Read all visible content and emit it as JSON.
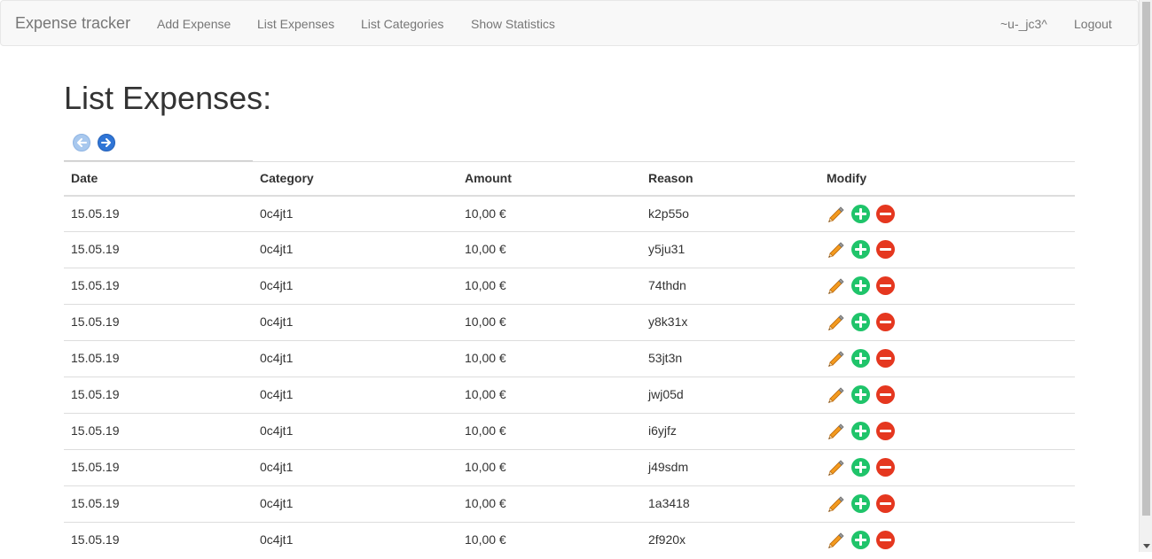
{
  "navbar": {
    "brand": "Expense tracker",
    "links": [
      {
        "label": "Add Expense"
      },
      {
        "label": "List Expenses"
      },
      {
        "label": "List Categories"
      },
      {
        "label": "Show Statistics"
      }
    ],
    "user": "~u-_jc3^",
    "logout": "Logout"
  },
  "page": {
    "title": "List Expenses:"
  },
  "pager": {
    "prev_icon": "arrow-left-circle-icon",
    "next_icon": "arrow-right-circle-icon"
  },
  "table": {
    "headers": {
      "date": "Date",
      "category": "Category",
      "amount": "Amount",
      "reason": "Reason",
      "modify": "Modify"
    },
    "rows": [
      {
        "date": "15.05.19",
        "category": "0c4jt1",
        "amount": "10,00 €",
        "reason": "k2p55o"
      },
      {
        "date": "15.05.19",
        "category": "0c4jt1",
        "amount": "10,00 €",
        "reason": "y5ju31"
      },
      {
        "date": "15.05.19",
        "category": "0c4jt1",
        "amount": "10,00 €",
        "reason": "74thdn"
      },
      {
        "date": "15.05.19",
        "category": "0c4jt1",
        "amount": "10,00 €",
        "reason": "y8k31x"
      },
      {
        "date": "15.05.19",
        "category": "0c4jt1",
        "amount": "10,00 €",
        "reason": "53jt3n"
      },
      {
        "date": "15.05.19",
        "category": "0c4jt1",
        "amount": "10,00 €",
        "reason": "jwj05d"
      },
      {
        "date": "15.05.19",
        "category": "0c4jt1",
        "amount": "10,00 €",
        "reason": "i6yjfz"
      },
      {
        "date": "15.05.19",
        "category": "0c4jt1",
        "amount": "10,00 €",
        "reason": "j49sdm"
      },
      {
        "date": "15.05.19",
        "category": "0c4jt1",
        "amount": "10,00 €",
        "reason": "1a3418"
      },
      {
        "date": "15.05.19",
        "category": "0c4jt1",
        "amount": "10,00 €",
        "reason": "2f920x"
      }
    ],
    "row_actions": [
      "pencil-icon",
      "plus-circle-icon",
      "minus-circle-icon"
    ]
  },
  "colors": {
    "navbar_bg": "#f8f8f8",
    "nav_text": "#777777",
    "add_green": "#1fc46a",
    "delete_red": "#e5371f",
    "pager_blue": "#2f75d6"
  }
}
